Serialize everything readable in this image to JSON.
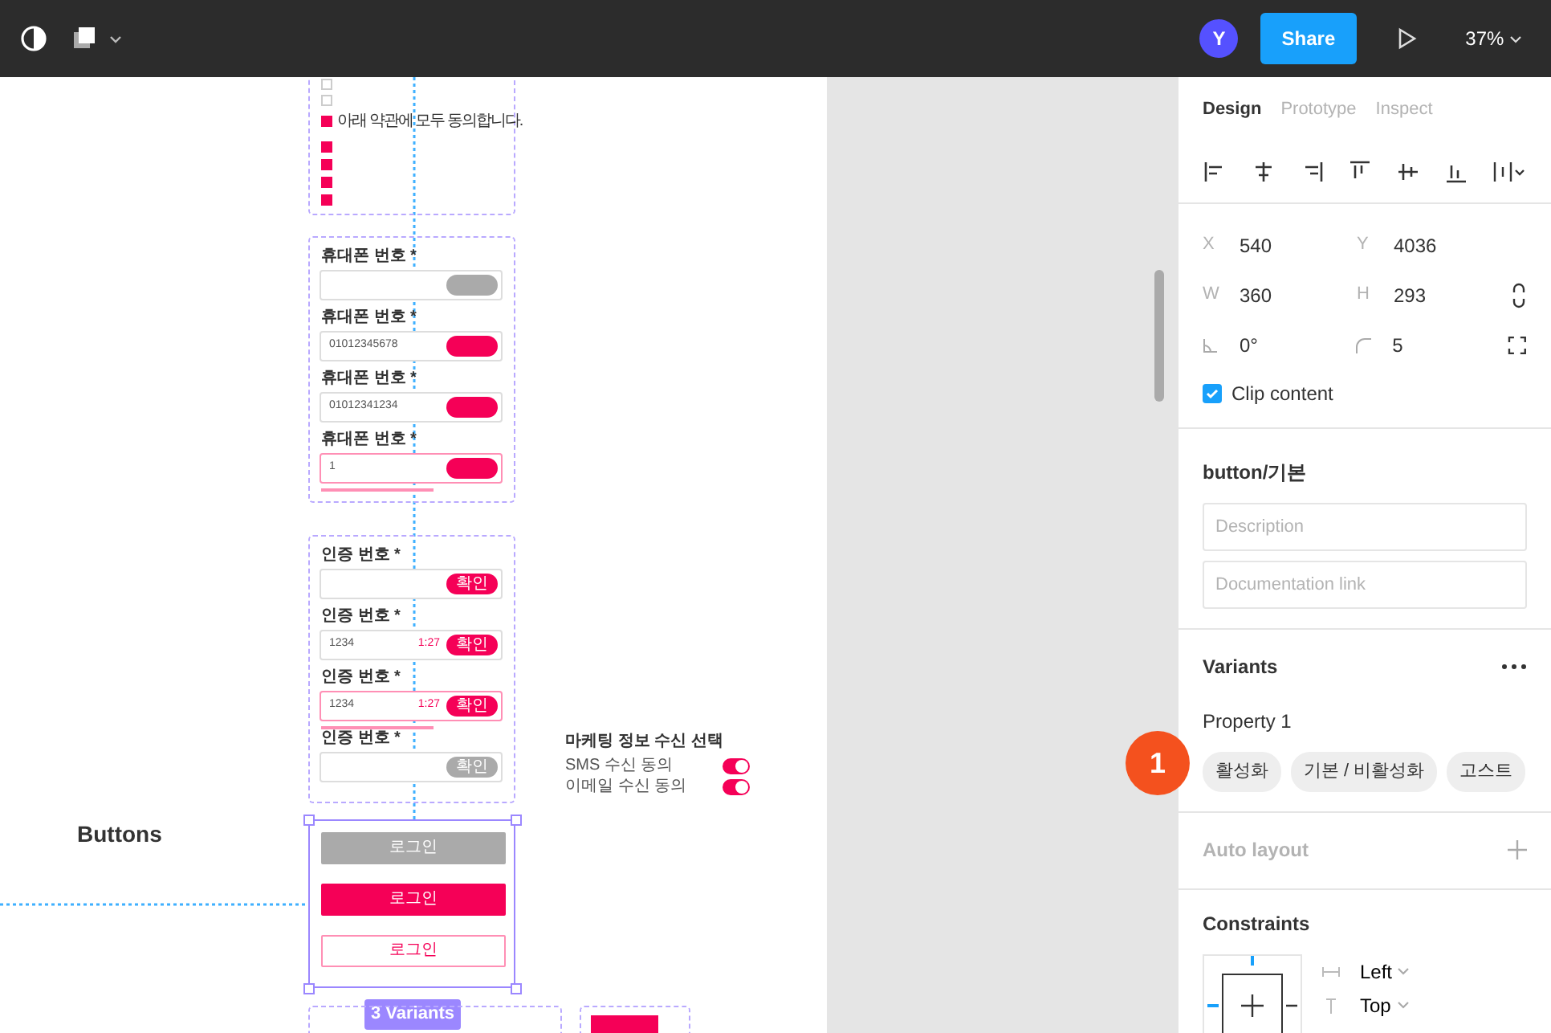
{
  "toolbar": {
    "avatar": "Y",
    "share": "Share",
    "zoom": "37%"
  },
  "canvas": {
    "title": "Buttons",
    "agreement": {
      "label": "아래 약관에 모두 동의합니다.",
      "checked": true,
      "items": [
        {
          "checked": false
        },
        {
          "checked": false
        },
        {
          "checked": true
        },
        {
          "checked": true
        },
        {
          "checked": true
        },
        {
          "checked": true
        }
      ]
    },
    "phone_fields": [
      {
        "label": "휴대폰 번호 *",
        "kind": "disabled"
      },
      {
        "label": "휴대폰 번호 *",
        "value": "01012345678",
        "kind": "active"
      },
      {
        "label": "휴대폰 번호 *",
        "value": "01012341234",
        "kind": "active"
      },
      {
        "label": "휴대폰 번호 *",
        "value": "1",
        "kind": "error"
      }
    ],
    "code_fields": [
      {
        "label": "인증 번호 *",
        "button": "확인",
        "kind": "active"
      },
      {
        "label": "인증 번호 *",
        "value": "1234",
        "timer": "1:27",
        "button": "확인",
        "kind": "active"
      },
      {
        "label": "인증 번호 *",
        "value": "1234",
        "timer": "1:27",
        "button": "확인",
        "kind": "error"
      },
      {
        "label": "인증 번호 *",
        "button": "확인",
        "kind": "disabled"
      }
    ],
    "marketing": {
      "title": "마케팅 정보 수신 선택",
      "options": [
        {
          "label": "SMS 수신 동의",
          "on": true
        },
        {
          "label": "이메일 수신 동의",
          "on": true
        }
      ]
    },
    "buttons": [
      {
        "label": "로그인",
        "kind": "disabled"
      },
      {
        "label": "로그인",
        "kind": "filled"
      },
      {
        "label": "로그인",
        "kind": "ghost"
      }
    ],
    "variants_badge": "3 Variants"
  },
  "panel": {
    "tabs": [
      {
        "label": "Design",
        "selected": true
      },
      {
        "label": "Prototype",
        "selected": false
      },
      {
        "label": "Inspect",
        "selected": false
      }
    ],
    "props": [
      {
        "label": "X",
        "value": "540"
      },
      {
        "label": "Y",
        "value": "4036"
      },
      {
        "label": "W",
        "value": "360"
      },
      {
        "label": "H",
        "value": "293"
      }
    ],
    "rotation": "0°",
    "radius": "5",
    "clip": {
      "label": "Clip content",
      "checked": true
    },
    "component": {
      "name": "button/기본",
      "description_placeholder": "Description",
      "link_placeholder": "Documentation link"
    },
    "variants": {
      "title": "Variants",
      "property": "Property 1",
      "values": [
        "활성화",
        "기본 / 비활성화",
        "고스트"
      ]
    },
    "step_badge": "1",
    "auto_layout": {
      "title": "Auto layout",
      "disabled": true
    },
    "constraints": {
      "title": "Constraints",
      "horizontal": "Left",
      "vertical": "Top"
    }
  }
}
